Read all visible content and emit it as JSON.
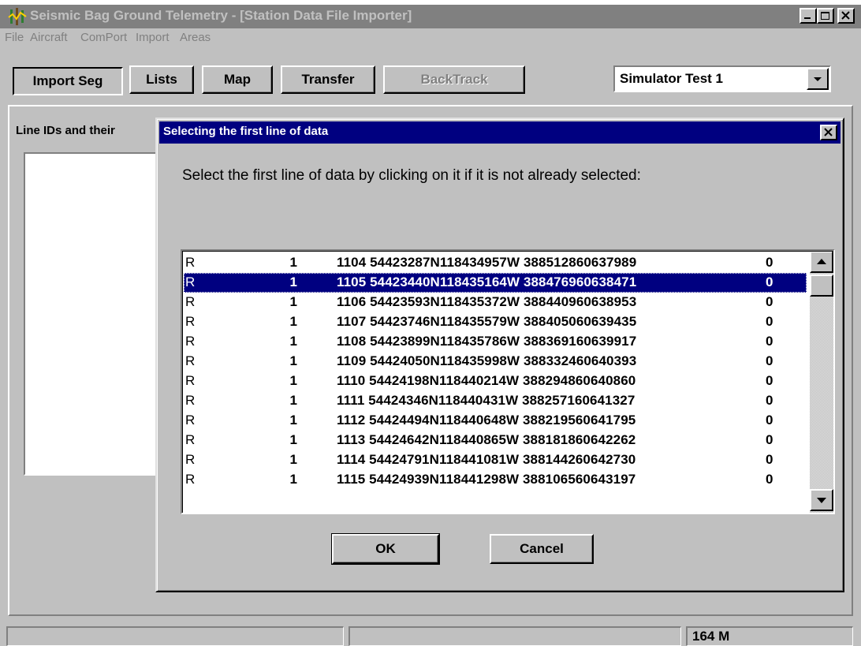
{
  "window": {
    "title": "Seismic Bag Ground Telemetry - [Station Data File Importer]"
  },
  "menu": {
    "items": [
      "File",
      "Aircraft",
      "ComPort",
      "Import",
      "Areas"
    ]
  },
  "toolbar": {
    "import_seg": "Import Seg",
    "lists": "Lists",
    "map": "Map",
    "transfer": "Transfer",
    "backtrack": "BackTrack",
    "combo_value": "Simulator Test 1"
  },
  "panel": {
    "label": "Line IDs and their"
  },
  "status": {
    "memory": "164 M"
  },
  "dialog": {
    "title": "Selecting the first line of data",
    "prompt": "Select the first line of data by clicking on it if it is not already selected:",
    "selected_index": 1,
    "rows": [
      {
        "code": "R",
        "num": "1",
        "data": "1104 54423287N118434957W 388512860637989",
        "flag": "0"
      },
      {
        "code": "R",
        "num": "1",
        "data": "1105 54423440N118435164W 388476960638471",
        "flag": "0"
      },
      {
        "code": "R",
        "num": "1",
        "data": "1106 54423593N118435372W 388440960638953",
        "flag": "0"
      },
      {
        "code": "R",
        "num": "1",
        "data": "1107 54423746N118435579W 388405060639435",
        "flag": "0"
      },
      {
        "code": "R",
        "num": "1",
        "data": "1108 54423899N118435786W 388369160639917",
        "flag": "0"
      },
      {
        "code": "R",
        "num": "1",
        "data": "1109 54424050N118435998W 388332460640393",
        "flag": "0"
      },
      {
        "code": "R",
        "num": "1",
        "data": "1110 54424198N118440214W 388294860640860",
        "flag": "0"
      },
      {
        "code": "R",
        "num": "1",
        "data": "1111 54424346N118440431W 388257160641327",
        "flag": "0"
      },
      {
        "code": "R",
        "num": "1",
        "data": "1112 54424494N118440648W 388219560641795",
        "flag": "0"
      },
      {
        "code": "R",
        "num": "1",
        "data": "1113 54424642N118440865W 388181860642262",
        "flag": "0"
      },
      {
        "code": "R",
        "num": "1",
        "data": "1114 54424791N118441081W 388144260642730",
        "flag": "0"
      },
      {
        "code": "R",
        "num": "1",
        "data": "1115 54424939N118441298W 388106560643197",
        "flag": "0"
      }
    ],
    "ok_label": "OK",
    "cancel_label": "Cancel"
  },
  "icons": {
    "app": "seismic-app-icon",
    "minimize": "minimize-icon",
    "maximize": "maximize-icon",
    "close": "close-icon",
    "combo": "chevron-down-icon",
    "scroll_up": "scroll-up-arrow-icon",
    "scroll_down": "scroll-down-arrow-icon"
  },
  "colors": {
    "dialog_titlebar": "#000080",
    "selection": "#000080",
    "face": "#c0c0c0",
    "inactive_titlebar": "#808080"
  }
}
